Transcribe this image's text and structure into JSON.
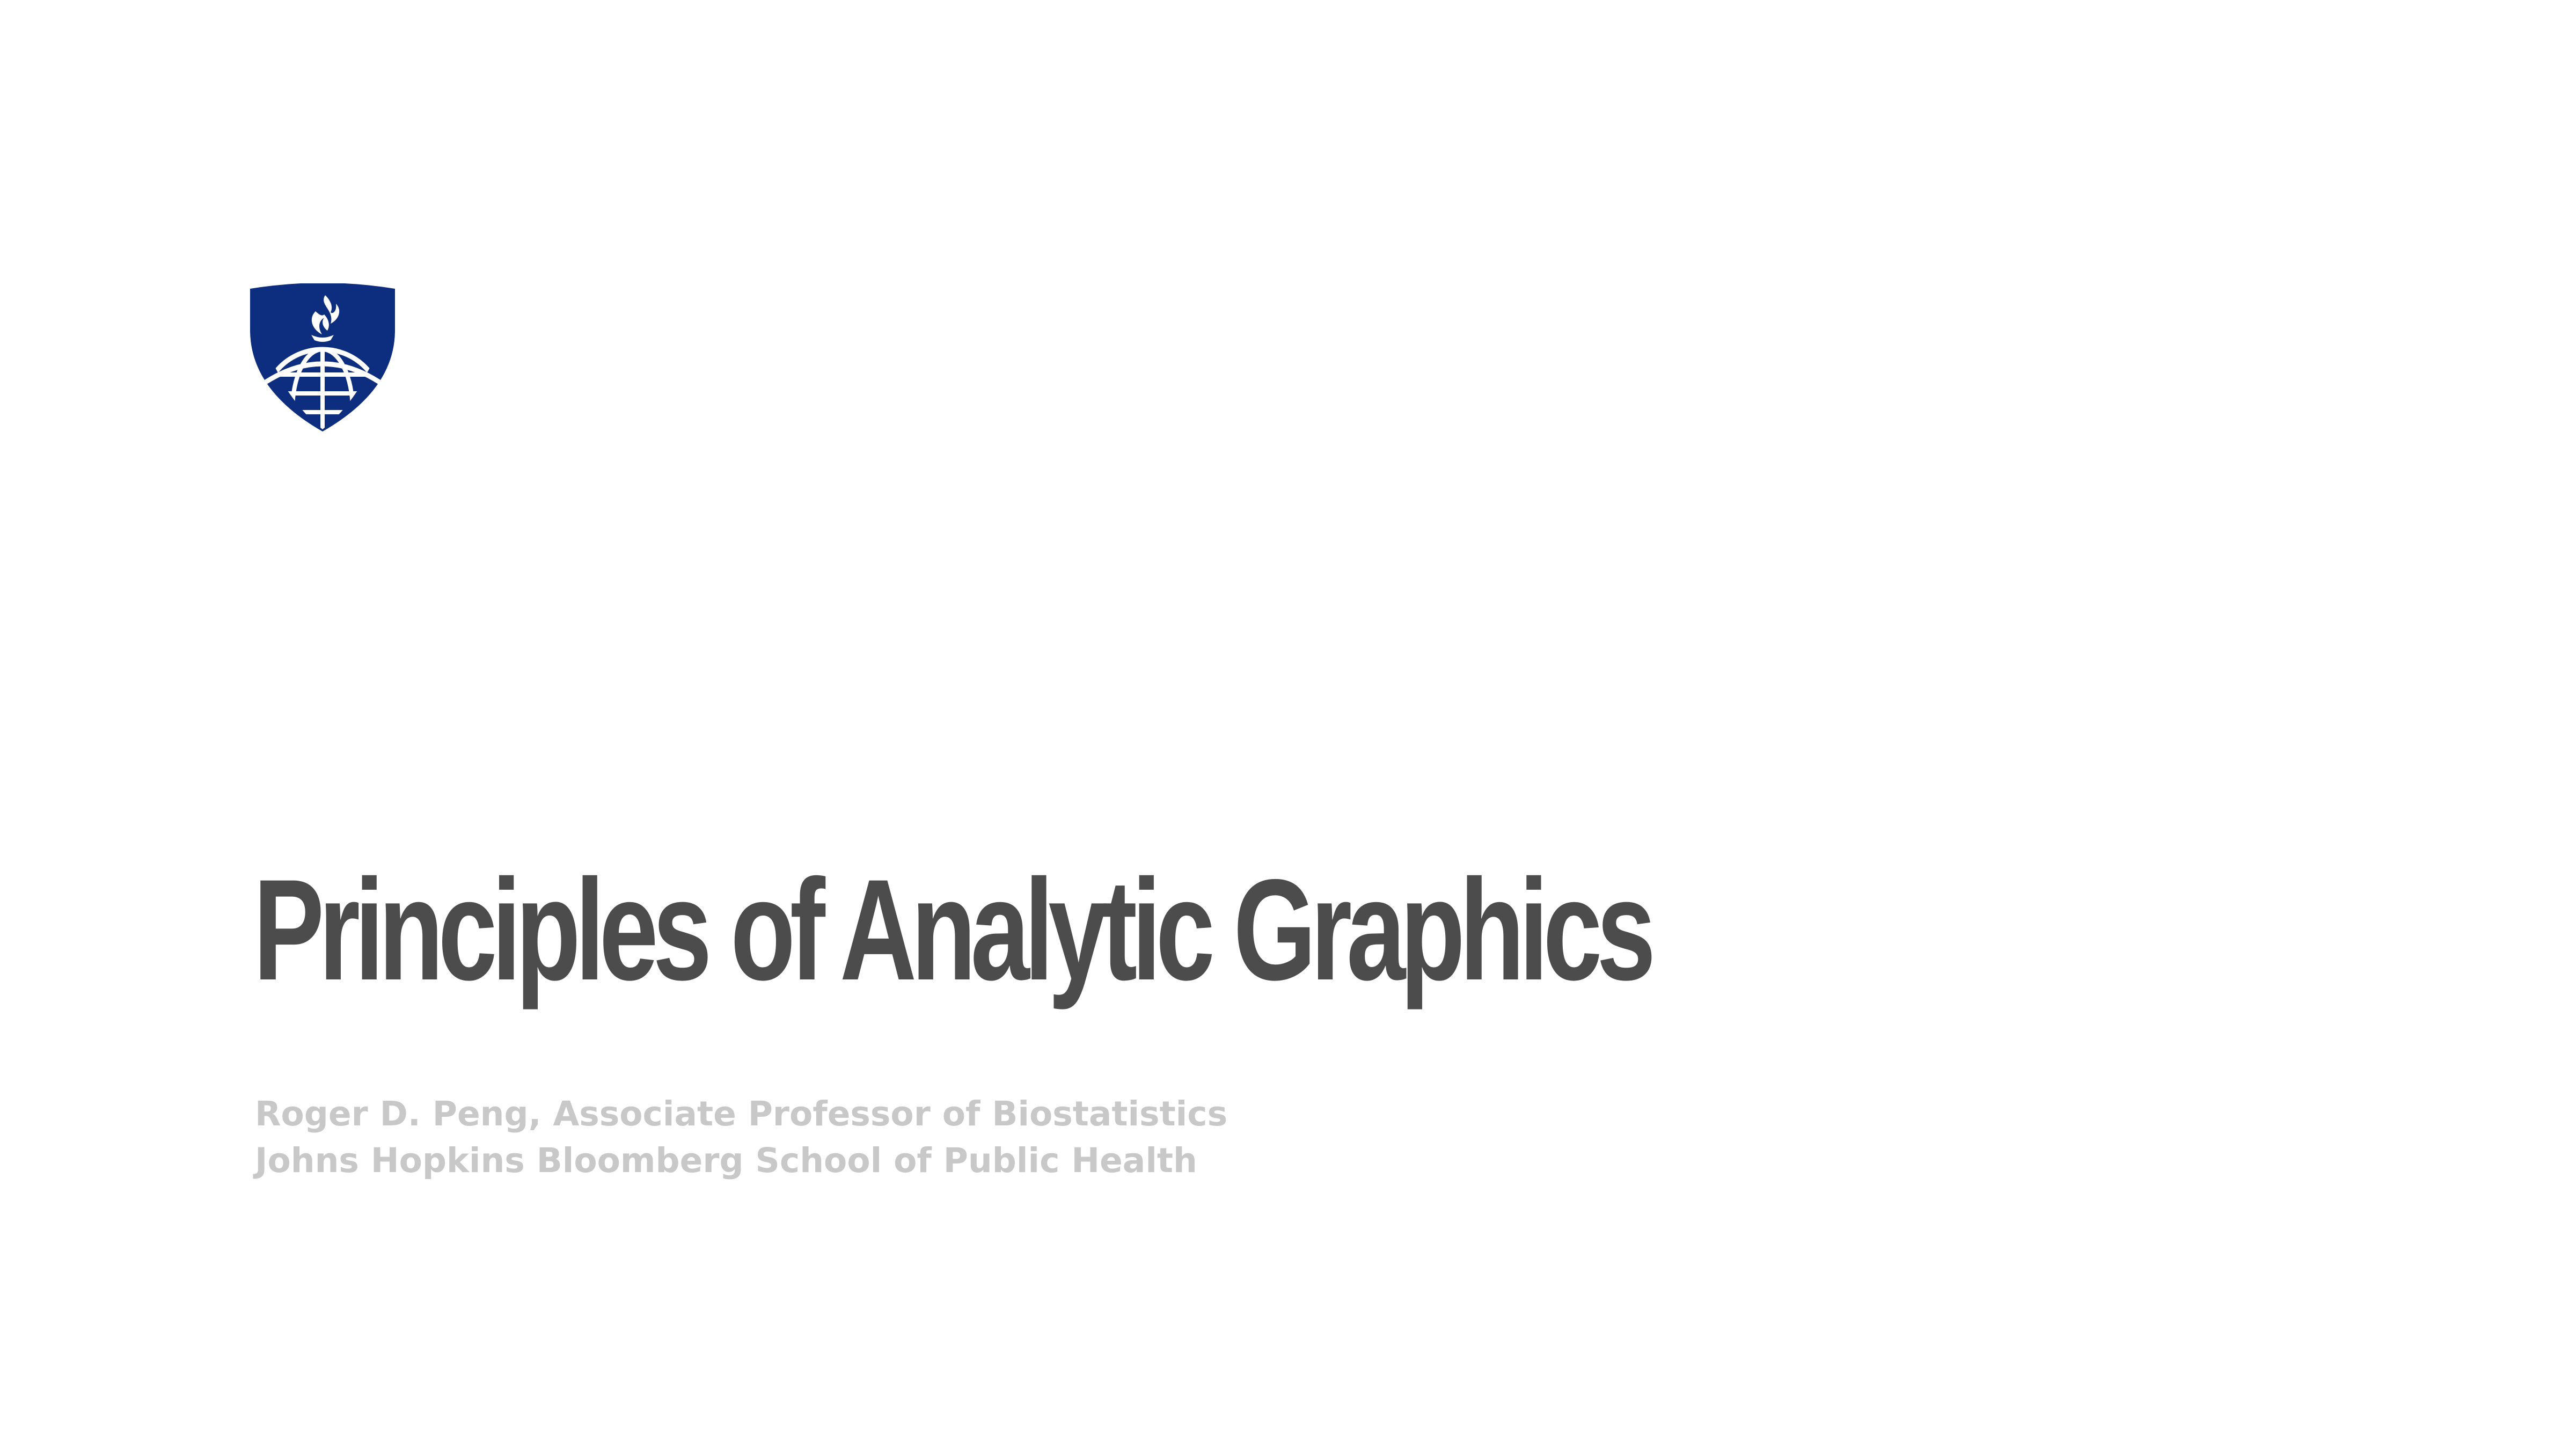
{
  "slide": {
    "title": "Principles of Analytic Graphics",
    "author_line": "Roger D. Peng, Associate Professor of Biostatistics",
    "affiliation_line": "Johns Hopkins Bloomberg School of Public Health",
    "logo": {
      "icon": "jhu-shield-globe-torch-icon",
      "color": "#0d2d7e"
    }
  }
}
